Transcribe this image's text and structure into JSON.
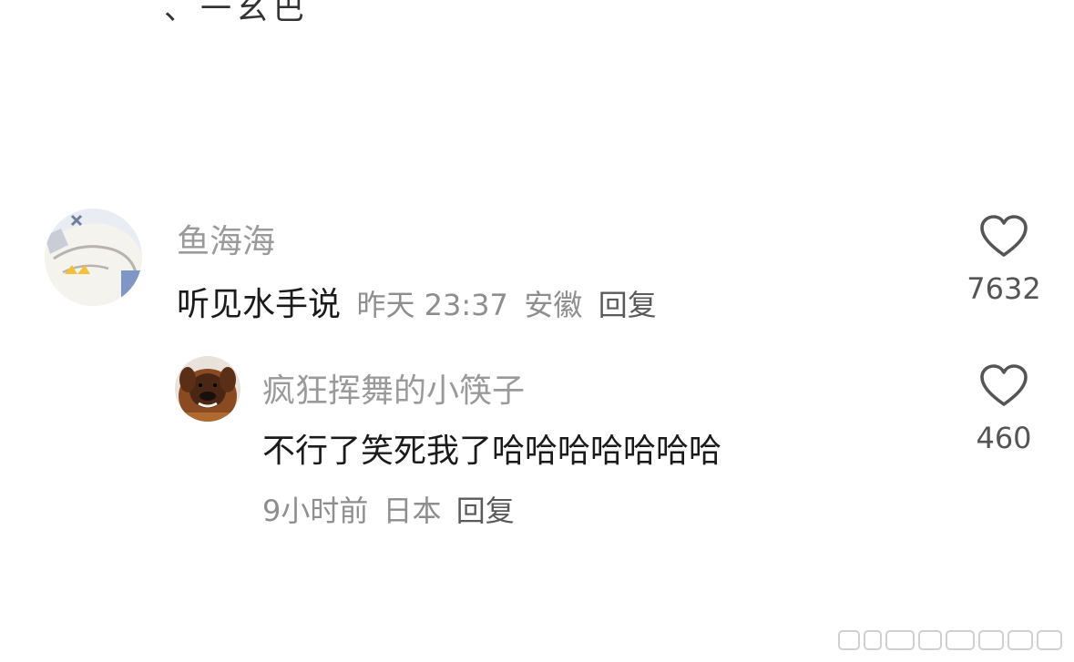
{
  "top_partial_text": "、一幺巴",
  "comments": [
    {
      "username": "鱼海海",
      "content": "听见水手说",
      "time": "昨天 23:37",
      "location": "安徽",
      "reply_label": "回复",
      "likes": "7632"
    },
    {
      "username": "疯狂挥舞的小筷子",
      "content": "不行了笑死我了哈哈哈哈哈哈哈",
      "time": "9小时前",
      "location": "日本",
      "reply_label": "回复",
      "likes": "460"
    }
  ],
  "icons": {
    "like": "heart-outline-icon",
    "avatar_1": "cartoon-fish-avatar",
    "avatar_2": "dog-avatar"
  },
  "colors": {
    "background": "#ffffff",
    "username": "#9a9a9a",
    "content": "#1b1b1b",
    "meta": "#8e8e8e",
    "reply": "#5a5a5a",
    "heart": "#555555"
  }
}
